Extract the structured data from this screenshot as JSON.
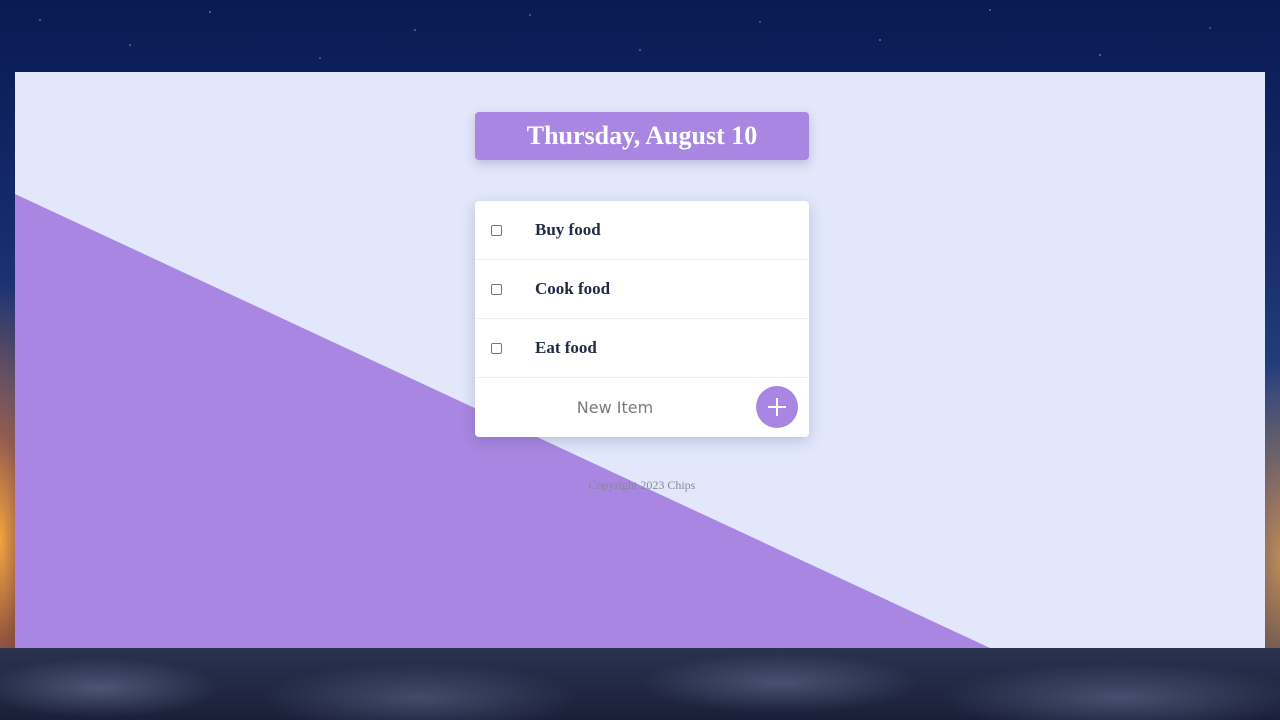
{
  "header": {
    "date": "Thursday, August 10"
  },
  "todo": {
    "items": [
      {
        "label": "Buy food",
        "checked": false
      },
      {
        "label": "Cook food",
        "checked": false
      },
      {
        "label": "Eat food",
        "checked": false
      }
    ],
    "new_item_placeholder": "New Item",
    "add_button_icon": "plus-icon"
  },
  "footer": {
    "copyright": "Copyright 2023 Chips"
  },
  "colors": {
    "accent": "#a886e1",
    "panel_background": "#e2e7fb",
    "card_background": "#ffffff",
    "item_text": "#1f2a44"
  }
}
